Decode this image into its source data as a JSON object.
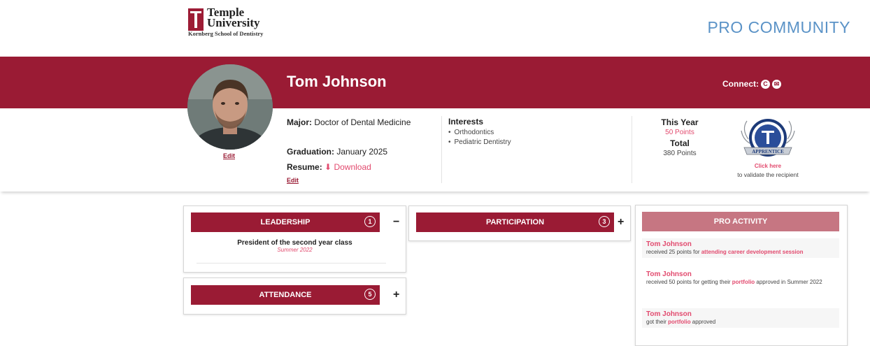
{
  "header": {
    "logo_line1": "Temple",
    "logo_line2": "University",
    "logo_sub": "Kornberg School of Dentistry",
    "pro_community": "PRO COMMUNITY"
  },
  "profile": {
    "name": "Tom Johnson",
    "connect_label": "Connect:",
    "photo_edit": "Edit",
    "major_label": "Major:",
    "major_value": "Doctor of Dental Medicine",
    "graduation_label": "Graduation:",
    "graduation_value": "January 2025",
    "resume_label": "Resume:",
    "resume_link": "Download",
    "info_edit": "Edit"
  },
  "interests": {
    "title": "Interests",
    "items": [
      "Orthodontics",
      "Pediatric Dentistry"
    ]
  },
  "points": {
    "this_year_label": "This Year",
    "this_year_value": "50 Points",
    "total_label": "Total",
    "total_value": "380 Points"
  },
  "badge": {
    "click_here": "Click here",
    "subtext": "to validate the recipient",
    "label": "APPRENTICE"
  },
  "sections": {
    "leadership": {
      "title": "LEADERSHIP",
      "count": "1",
      "toggle": "−",
      "items": [
        {
          "title": "President of the second year class",
          "date": "Summer 2022"
        }
      ]
    },
    "attendance": {
      "title": "ATTENDANCE",
      "count": "5",
      "toggle": "+"
    },
    "participation": {
      "title": "PARTICIPATION",
      "count": "3",
      "toggle": "+"
    }
  },
  "pro_activity": {
    "title": "PRO ACTIVITY",
    "items": [
      {
        "name": "Tom Johnson",
        "pre": "received 25 points for ",
        "highlight": "attending career development session",
        "post": ""
      },
      {
        "name": "Tom Johnson",
        "pre": "received 50 points for getting their ",
        "highlight": "portfolio",
        "post": " approved in Summer 2022"
      },
      {
        "name": "Tom Johnson",
        "pre": "got their ",
        "highlight": "portfolio",
        "post": " approved"
      }
    ]
  },
  "colors": {
    "brand_red": "#9a1b34",
    "accent_pink": "#e24a6e",
    "pro_blue": "#5b93c7",
    "activity_header": "#c67682"
  }
}
